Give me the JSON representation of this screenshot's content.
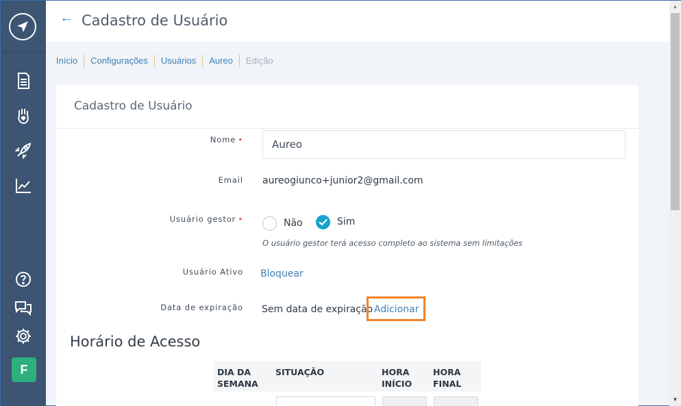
{
  "header": {
    "title": "Cadastro de Usuário",
    "back_icon": "arrow-left-icon"
  },
  "breadcrumb": [
    {
      "label": "Início"
    },
    {
      "label": "Configurações"
    },
    {
      "label": "Usuários"
    },
    {
      "label": "Aureo"
    },
    {
      "label": "Edição"
    }
  ],
  "sidebar": {
    "icons": [
      "document-icon",
      "hand-heart-icon",
      "rocket-icon",
      "trend-chart-icon",
      "help-icon",
      "chat-icon",
      "gear-icon"
    ],
    "avatar_letter": "F"
  },
  "card": {
    "title": "Cadastro de Usuário"
  },
  "form": {
    "nome_label": "Nome",
    "nome_value": "Aureo",
    "email_label": "Email",
    "email_value": "aureogiunco+junior2@gmail.com",
    "gestor_label": "Usuário gestor",
    "gestor_no": "Não",
    "gestor_yes": "Sim",
    "gestor_selected": "Sim",
    "gestor_hint": "O usuário gestor terá acesso completo ao sistema sem limitações",
    "ativo_label": "Usuário Ativo",
    "ativo_action": "Bloquear",
    "expiracao_label": "Data de expiração",
    "expiracao_value": "Sem data de expiração",
    "expiracao_action": "Adicionar",
    "required_mark": "•"
  },
  "access": {
    "title": "Horário de Acesso",
    "columns": [
      {
        "line1": "DIA DA",
        "line2": "SEMANA"
      },
      {
        "line1": "SITUAÇÃO",
        "line2": ""
      },
      {
        "line1": "HORA",
        "line2": "INÍCIO"
      },
      {
        "line1": "HORA",
        "line2": "FINAL"
      }
    ]
  },
  "colors": {
    "sidebar": "#3d5573",
    "accent": "#17a2d0",
    "link": "#3f7fb5",
    "highlight": "#f48024",
    "avatar": "#2eaf7d"
  }
}
